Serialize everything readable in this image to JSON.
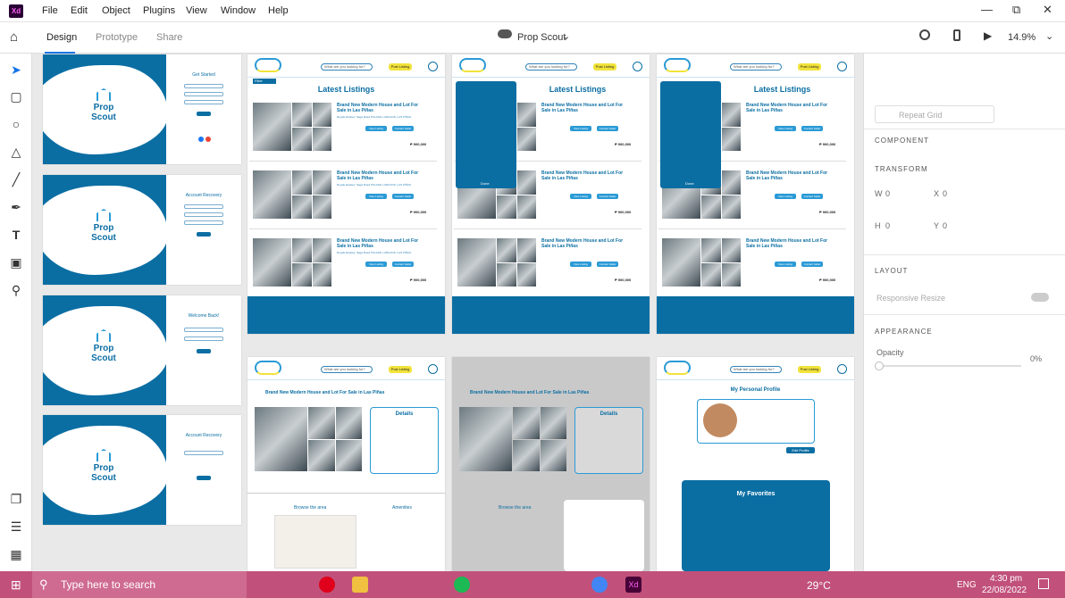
{
  "app": {
    "logo": "Xd"
  },
  "menu": [
    "File",
    "Edit",
    "Object",
    "Plugins",
    "View",
    "Window",
    "Help"
  ],
  "modes": {
    "design": "Design",
    "prototype": "Prototype",
    "share": "Share"
  },
  "document": {
    "name": "Prop Scout"
  },
  "zoom": "14.9%",
  "right_panel": {
    "repeat_grid": "Repeat Grid",
    "component": "COMPONENT",
    "transform": "TRANSFORM",
    "w_label": "W",
    "w_value": "0",
    "x_label": "X",
    "x_value": "0",
    "h_label": "H",
    "h_value": "0",
    "y_label": "Y",
    "y_value": "0",
    "layout": "LAYOUT",
    "responsive": "Responsive Resize",
    "appearance": "APPEARANCE",
    "opacity": "Opacity",
    "opacity_value": "0%"
  },
  "taskbar": {
    "search_placeholder": "Type here to search",
    "weather": "29°C",
    "lang": "ENG",
    "time": "4:30 pm",
    "date": "22/08/2022"
  },
  "auth_screens": [
    {
      "title": "Get Started"
    },
    {
      "title": "Account Recovery"
    },
    {
      "title": "Welcome Back!"
    },
    {
      "title": "Account Recovery"
    }
  ],
  "logo_text": {
    "line1": "Prop",
    "line2": "Scout"
  },
  "site": {
    "search_placeholder": "What are you looking for?",
    "nav_button": "Post Listing",
    "latest": "Latest Listings",
    "listing_title": "Brand New Modern House and Lot For Sale in Las Piñas",
    "address": "Royale Estates, Naga Road PULANG LUPA DOS, LAS PIÑAS",
    "view_listing": "View Listing",
    "contact_seller": "Contact Seller",
    "price": "₱ 900,000",
    "filter": "Filter",
    "done": "Done",
    "details": "Details",
    "browse": "Browse the area",
    "amenities": "Amenities",
    "profile": "My Personal Profile",
    "favorites": "My Favorites",
    "edit_profile": "Edit Profile"
  }
}
